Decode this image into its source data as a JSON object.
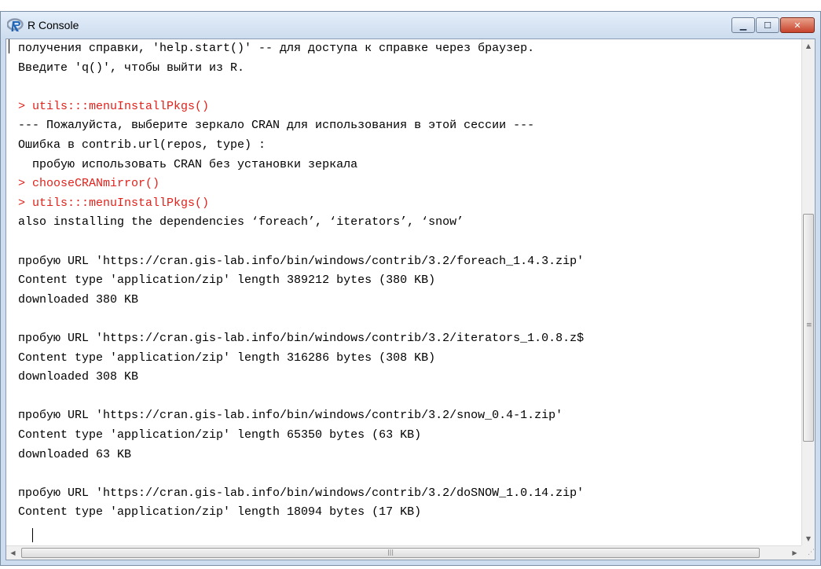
{
  "window": {
    "title": "R Console",
    "icon": "r-logo-icon",
    "controls": {
      "minimize_icon": "minimize-icon",
      "maximize_icon": "maximize-icon",
      "close_icon": "close-icon"
    }
  },
  "console": {
    "lines": [
      {
        "text": "получения справки, 'help.start()' -- для доступа к справке через браузер.",
        "kind": "output"
      },
      {
        "text": "Введите 'q()', чтобы выйти из R.",
        "kind": "output"
      },
      {
        "text": "",
        "kind": "blank"
      },
      {
        "text": "> utils:::menuInstallPkgs()",
        "kind": "input"
      },
      {
        "text": "--- Пожалуйста, выберите зеркало CRAN для использования в этой сессии ---",
        "kind": "output"
      },
      {
        "text": "Ошибка в contrib.url(repos, type) :",
        "kind": "output"
      },
      {
        "text": "  пробую использовать CRAN без установки зеркала",
        "kind": "output"
      },
      {
        "text": "> chooseCRANmirror()",
        "kind": "input"
      },
      {
        "text": "> utils:::menuInstallPkgs()",
        "kind": "input"
      },
      {
        "text": "also installing the dependencies ‘foreach’, ‘iterators’, ‘snow’",
        "kind": "output"
      },
      {
        "text": "",
        "kind": "blank"
      },
      {
        "text": "пробую URL 'https://cran.gis-lab.info/bin/windows/contrib/3.2/foreach_1.4.3.zip'",
        "kind": "output"
      },
      {
        "text": "Content type 'application/zip' length 389212 bytes (380 KB)",
        "kind": "output"
      },
      {
        "text": "downloaded 380 KB",
        "kind": "output"
      },
      {
        "text": "",
        "kind": "blank"
      },
      {
        "text": "пробую URL 'https://cran.gis-lab.info/bin/windows/contrib/3.2/iterators_1.0.8.z$",
        "kind": "output"
      },
      {
        "text": "Content type 'application/zip' length 316286 bytes (308 KB)",
        "kind": "output"
      },
      {
        "text": "downloaded 308 KB",
        "kind": "output"
      },
      {
        "text": "",
        "kind": "blank"
      },
      {
        "text": "пробую URL 'https://cran.gis-lab.info/bin/windows/contrib/3.2/snow_0.4-1.zip'",
        "kind": "output"
      },
      {
        "text": "Content type 'application/zip' length 65350 bytes (63 KB)",
        "kind": "output"
      },
      {
        "text": "downloaded 63 KB",
        "kind": "output"
      },
      {
        "text": "",
        "kind": "blank"
      },
      {
        "text": "пробую URL 'https://cran.gis-lab.info/bin/windows/contrib/3.2/doSNOW_1.0.14.zip'",
        "kind": "output"
      },
      {
        "text": "Content type 'application/zip' length 18094 bytes (17 KB)",
        "kind": "output"
      }
    ],
    "input_color": "#e2221b",
    "output_color": "#000000"
  },
  "scrollbars": {
    "vertical": {
      "up_icon": "scroll-up-arrow-icon",
      "down_icon": "scroll-down-arrow-icon"
    },
    "horizontal": {
      "left_icon": "scroll-left-arrow-icon",
      "right_icon": "scroll-right-arrow-icon"
    }
  }
}
